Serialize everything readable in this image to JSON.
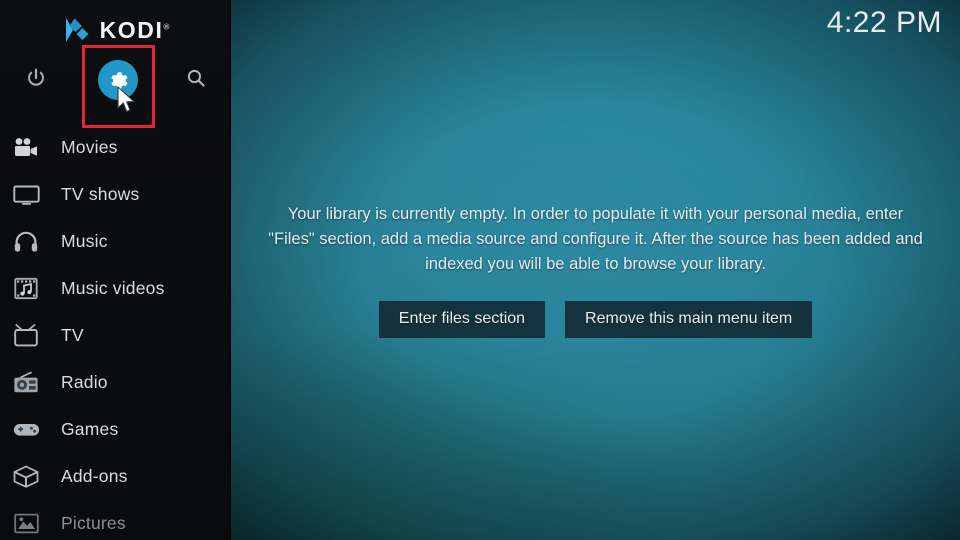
{
  "app": {
    "name": "KODI",
    "trademark": "®",
    "logo_icon": "kodi-logo-icon",
    "accent_color": "#2297ca",
    "highlight_color": "#e32636"
  },
  "clock": {
    "time": "4:22 PM"
  },
  "sidebar": {
    "top_icons": [
      {
        "name": "power-icon",
        "label": "Power"
      },
      {
        "name": "settings-gear-icon",
        "label": "Settings",
        "selected": true
      },
      {
        "name": "search-icon",
        "label": "Search"
      }
    ],
    "items": [
      {
        "label": "Movies",
        "icon": "movie-camera-icon",
        "dim": false
      },
      {
        "label": "TV shows",
        "icon": "television-icon",
        "dim": false
      },
      {
        "label": "Music",
        "icon": "headphones-icon",
        "dim": false
      },
      {
        "label": "Music videos",
        "icon": "film-music-icon",
        "dim": false
      },
      {
        "label": "TV",
        "icon": "tv-antenna-icon",
        "dim": false
      },
      {
        "label": "Radio",
        "icon": "radio-icon",
        "dim": false
      },
      {
        "label": "Games",
        "icon": "gamepad-icon",
        "dim": false
      },
      {
        "label": "Add-ons",
        "icon": "open-box-icon",
        "dim": false
      },
      {
        "label": "Pictures",
        "icon": "picture-icon",
        "dim": true
      }
    ]
  },
  "main": {
    "empty_message": "Your library is currently empty. In order to populate it with your personal media, enter \"Files\" section, add a media source and configure it. After the source has been added and indexed you will be able to browse your library.",
    "buttons": [
      {
        "label": "Enter files section"
      },
      {
        "label": "Remove this main menu item"
      }
    ]
  }
}
